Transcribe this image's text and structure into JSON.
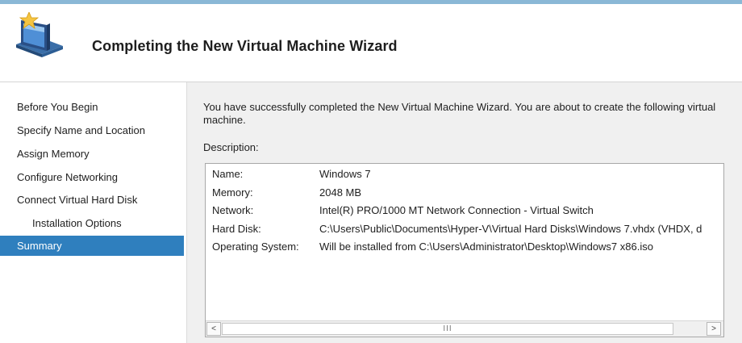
{
  "header": {
    "title": "Completing the New Virtual Machine Wizard",
    "icon": "wizard-monitor-star-icon"
  },
  "nav": {
    "items": [
      {
        "label": "Before You Begin",
        "selected": false,
        "indent": false
      },
      {
        "label": "Specify Name and Location",
        "selected": false,
        "indent": false
      },
      {
        "label": "Assign Memory",
        "selected": false,
        "indent": false
      },
      {
        "label": "Configure Networking",
        "selected": false,
        "indent": false
      },
      {
        "label": "Connect Virtual Hard Disk",
        "selected": false,
        "indent": false
      },
      {
        "label": "Installation Options",
        "selected": false,
        "indent": true
      },
      {
        "label": "Summary",
        "selected": true,
        "indent": false
      }
    ]
  },
  "main": {
    "intro": "You have successfully completed the New Virtual Machine Wizard. You are about to create the following virtual machine.",
    "description_label": "Description:",
    "description": [
      {
        "key": "Name:",
        "value": "Windows 7"
      },
      {
        "key": "Memory:",
        "value": "2048 MB"
      },
      {
        "key": "Network:",
        "value": "Intel(R) PRO/1000 MT Network Connection - Virtual Switch"
      },
      {
        "key": "Hard Disk:",
        "value": "C:\\Users\\Public\\Documents\\Hyper-V\\Virtual Hard Disks\\Windows 7.vhdx (VHDX, d"
      },
      {
        "key": "Operating System:",
        "value": "Will be installed from C:\\Users\\Administrator\\Desktop\\Windows7 x86.iso"
      }
    ],
    "scrollbar": {
      "left_arrow": "<",
      "right_arrow": ">",
      "thumb_grip": "III"
    }
  },
  "colors": {
    "selected_bg": "#2f7fbe",
    "selected_fg": "#ffffff",
    "accent_strip": "#8ab8d6"
  }
}
